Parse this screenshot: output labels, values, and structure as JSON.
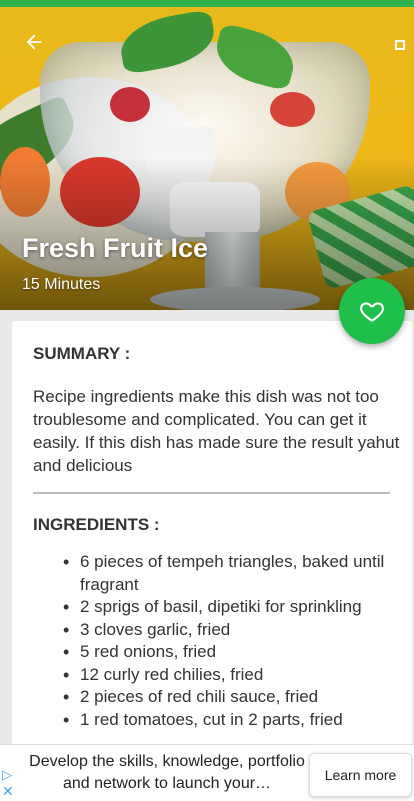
{
  "header": {
    "title": "Fresh Fruit Ice",
    "duration": "15 Minutes",
    "back_icon": "arrow-back-icon",
    "favorite_icon": "heart-outline-icon"
  },
  "summary": {
    "title": "SUMMARY :",
    "text": "Recipe ingredients make this dish was not too troublesome and complicated. You can get it easily. If this dish has made sure the result yahut and delicious"
  },
  "ingredients": {
    "title": "INGREDIENTS :",
    "items": [
      "6 pieces of tempeh triangles, baked until fragrant",
      "2 sprigs of basil, dipetiki for sprinkling",
      "3 cloves garlic, fried",
      "5 red onions, fried",
      "12 curly red chilies, fried",
      "2 pieces of red chili sauce, fried",
      "1 red tomatoes, cut in 2 parts, fried"
    ]
  },
  "ad": {
    "text": "Develop the skills, knowledge, portfolio and network to launch your…",
    "button": "Learn more"
  },
  "colors": {
    "accent": "#1fbf4c",
    "status_strip": "#2fb24a"
  }
}
